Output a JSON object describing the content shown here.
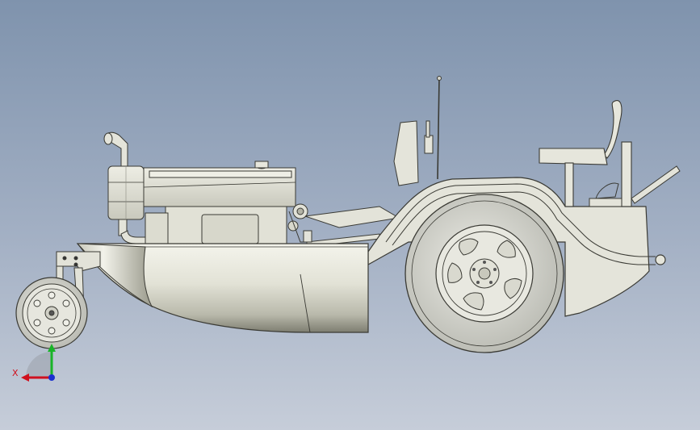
{
  "triad": {
    "x_label": "X",
    "colors": {
      "x": "#d0101e",
      "y": "#18b428",
      "z": "#1a2fd0"
    }
  },
  "palette": {
    "body": "#e6e6dc",
    "body_shade": "#c8c8bc",
    "outline": "#3a3a34",
    "tire": "#d2d3cc",
    "background_top": "#7f93ad",
    "background_bottom": "#c6cdd9"
  }
}
